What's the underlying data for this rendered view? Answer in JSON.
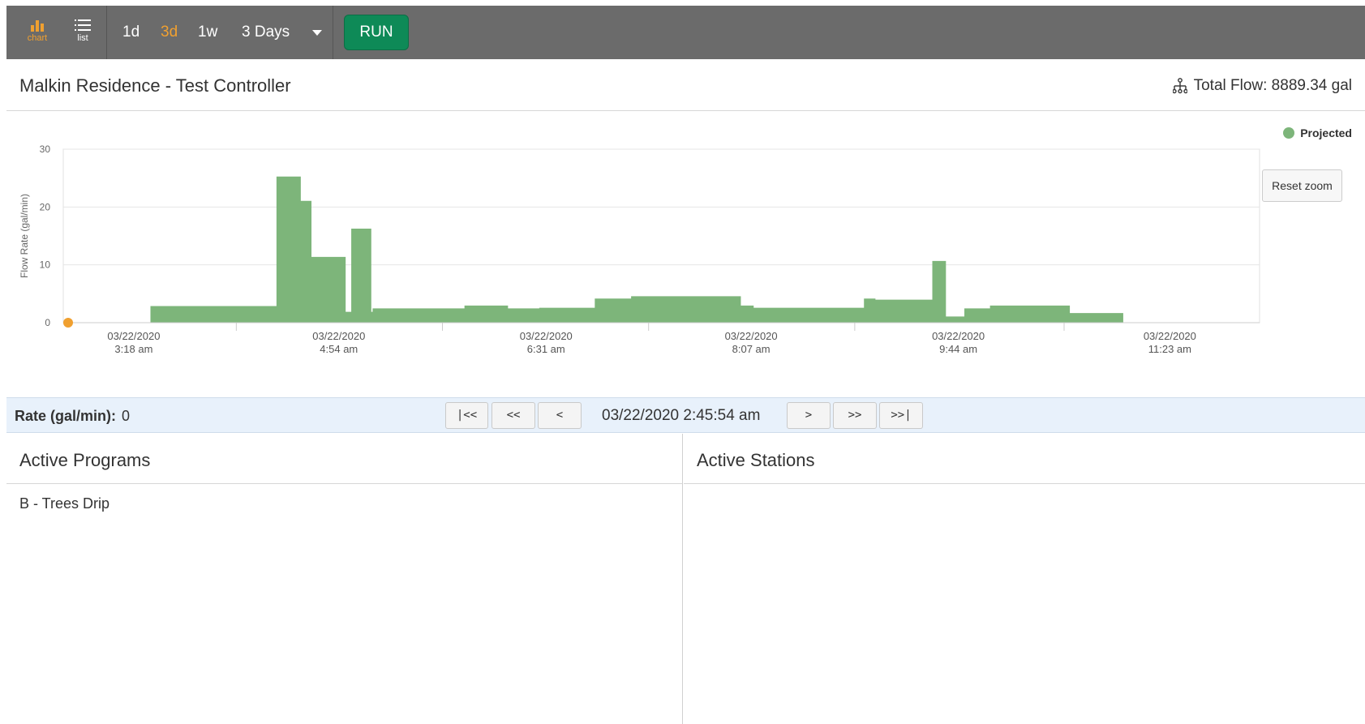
{
  "toolbar": {
    "views": [
      {
        "label": "chart",
        "icon": "bar-chart-icon",
        "active": true
      },
      {
        "label": "list",
        "icon": "list-icon",
        "active": false
      }
    ],
    "ranges": [
      {
        "label": "1d",
        "active": false
      },
      {
        "label": "3d",
        "active": true
      },
      {
        "label": "1w",
        "active": false
      }
    ],
    "selected_range": "3 Days",
    "run_label": "RUN",
    "colors": {
      "bar": "#6b6b6b",
      "active": "#f0a030",
      "run": "#0e8a57"
    }
  },
  "header": {
    "title": "Malkin Residence - Test Controller",
    "total_flow": "Total Flow: 8889.34 gal",
    "total_flow_icon": "flow-tree-icon"
  },
  "chart": {
    "reset_zoom_label": "Reset zoom"
  },
  "chart_data": {
    "type": "area",
    "title": "",
    "xlabel": "",
    "ylabel": "Flow Rate (gal/min)",
    "ylim": [
      0,
      30
    ],
    "y_ticks": [
      0,
      10,
      20,
      30
    ],
    "x_ticks": [
      {
        "date": "03/22/2020",
        "time": "3:18 am"
      },
      {
        "date": "03/22/2020",
        "time": "4:54 am"
      },
      {
        "date": "03/22/2020",
        "time": "6:31 am"
      },
      {
        "date": "03/22/2020",
        "time": "8:07 am"
      },
      {
        "date": "03/22/2020",
        "time": "9:44 am"
      },
      {
        "date": "03/22/2020",
        "time": "11:23 am"
      }
    ],
    "x_range": [
      "2:45",
      "12:05"
    ],
    "grid": true,
    "legend": "top-right",
    "series": [
      {
        "name": "Projected",
        "color": "#7db57a",
        "x": [
          "2:45",
          "3:26",
          "3:26",
          "4:25",
          "4:25",
          "4:36",
          "4:36",
          "4:41",
          "4:41",
          "4:57",
          "4:57",
          "5:00",
          "5:00",
          "5:09",
          "5:09",
          "5:10",
          "5:10",
          "5:31",
          "5:31",
          "5:53",
          "5:53",
          "6:13",
          "6:13",
          "6:28",
          "6:28",
          "6:54",
          "6:54",
          "7:05",
          "7:05",
          "7:11",
          "7:11",
          "8:02",
          "8:02",
          "8:08",
          "8:08",
          "9:00",
          "9:00",
          "9:05",
          "9:05",
          "9:32",
          "9:32",
          "9:38",
          "9:38",
          "9:47",
          "9:47",
          "9:59",
          "9:59",
          "10:36",
          "10:36",
          "11:01",
          "11:01",
          "11:38",
          "11:38",
          "12:05"
        ],
        "y": [
          0,
          0,
          2.8,
          2.8,
          25.2,
          25.2,
          21,
          21,
          11.3,
          11.3,
          1.8,
          1.8,
          16.2,
          16.2,
          1.8,
          1.8,
          2.4,
          2.4,
          2.4,
          2.4,
          2.9,
          2.9,
          2.4,
          2.4,
          2.5,
          2.5,
          4.1,
          4.1,
          4.1,
          4.1,
          4.5,
          4.5,
          2.9,
          2.9,
          2.5,
          2.5,
          4.1,
          4.1,
          3.9,
          3.9,
          10.6,
          10.6,
          1.0,
          1.0,
          2.4,
          2.4,
          2.9,
          2.9,
          1.6,
          1.6,
          0,
          0,
          0,
          0
        ]
      }
    ]
  },
  "nav": {
    "rate_label": "Rate (gal/min):",
    "rate_value": "0",
    "buttons": {
      "first": "|<<",
      "prev_big": "<<",
      "prev": "<",
      "next": ">",
      "next_big": ">>",
      "last": ">>|"
    },
    "date": "03/22/2020 2:45:54 am"
  },
  "programs": {
    "title": "Active Programs",
    "items": [
      "B - Trees Drip"
    ]
  },
  "stations": {
    "title": "Active Stations",
    "items": []
  }
}
